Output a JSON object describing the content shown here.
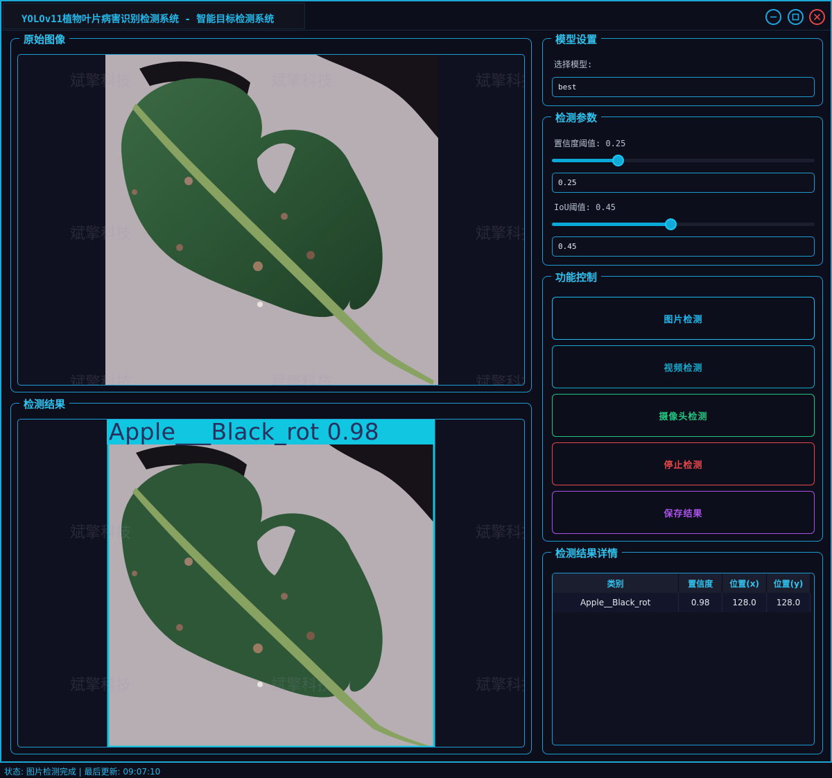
{
  "window": {
    "title": "YOLOv11植物叶片病害识别检测系统 - 智能目标检测系统"
  },
  "watermark": "斌擎科技",
  "original_panel": {
    "title": "原始图像"
  },
  "result_panel": {
    "title": "检测结果",
    "detection_label": "Apple___Black_rot 0.98"
  },
  "model_panel": {
    "title": "模型设置",
    "select_label": "选择模型:",
    "selected_model": "best"
  },
  "params_panel": {
    "title": "检测参数",
    "conf_label": "置信度阈值: 0.25",
    "conf_value": "0.25",
    "conf_level": 0.25,
    "iou_label": "IoU阈值: 0.45",
    "iou_value": "0.45",
    "iou_level": 0.45
  },
  "control_panel": {
    "title": "功能控制",
    "buttons": [
      {
        "label": "图片检测",
        "color": "#22b9ee"
      },
      {
        "label": "视频检测",
        "color": "#17a6c9"
      },
      {
        "label": "摄像头检测",
        "color": "#23c47f"
      },
      {
        "label": "停止检测",
        "color": "#e5484a"
      },
      {
        "label": "保存结果",
        "color": "#a853e6"
      }
    ]
  },
  "details_panel": {
    "title": "检测结果详情",
    "columns": [
      "类别",
      "置信度",
      "位置(x)",
      "位置(y)"
    ],
    "rows": [
      [
        "Apple__Black_rot",
        "0.98",
        "128.0",
        "128.0"
      ]
    ]
  },
  "status_bar": {
    "text": "状态: 图片检测完成 | 最后更新: 09:07:10"
  },
  "colors": {
    "accent": "#1e9bd0",
    "title": "#31c2ee",
    "detection_box": "#10c6e0"
  }
}
